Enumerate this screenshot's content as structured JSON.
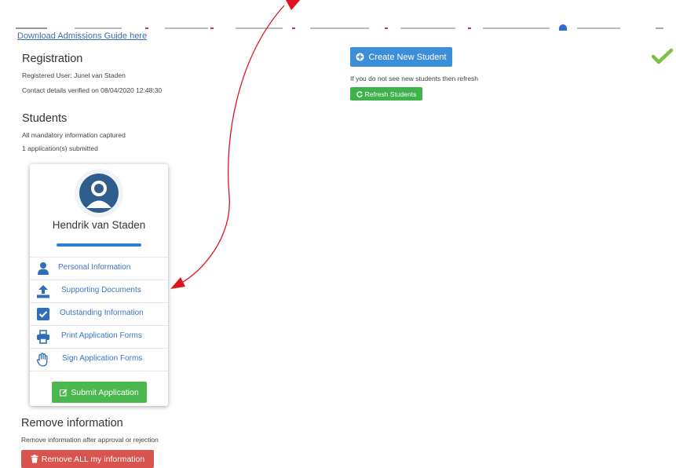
{
  "header": {
    "guide_link": "Download Admissions Guide here"
  },
  "registration": {
    "title": "Registration",
    "registered_user": "Registered User: Junel van Staden",
    "contact_verified": "Contact details verified on 08/04/2020 12:48:30"
  },
  "students": {
    "title": "Students",
    "mandatory": "All mandatory information captured",
    "submitted": "1 application(s) submitted"
  },
  "actions": {
    "create_student": "Create New Student",
    "refresh_hint": "If you do not see new students then refresh",
    "refresh_students": "Refresh Students"
  },
  "student_card": {
    "name": "Hendrik van Staden",
    "progress": 1.0,
    "menu": [
      {
        "label": "Personal Information",
        "icon": "person-icon"
      },
      {
        "label": "Supporting Documents",
        "icon": "upload-icon"
      },
      {
        "label": "Outstanding Information",
        "icon": "checkbox-icon"
      },
      {
        "label": "Print Application Forms",
        "icon": "printer-icon"
      },
      {
        "label": "Sign Application Forms",
        "icon": "hand-icon"
      }
    ],
    "submit": "Submit Application"
  },
  "remove": {
    "title": "Remove information",
    "hint": "Remove information after approval or rejection",
    "button": "Remove ALL my information"
  },
  "colors": {
    "primary_blue": "#3d8ed8",
    "success_green": "#3db34a",
    "danger_red": "#d9534f",
    "link_blue": "#3d74c4",
    "annotation_red": "#e0141e",
    "check_green": "#7cc242"
  }
}
